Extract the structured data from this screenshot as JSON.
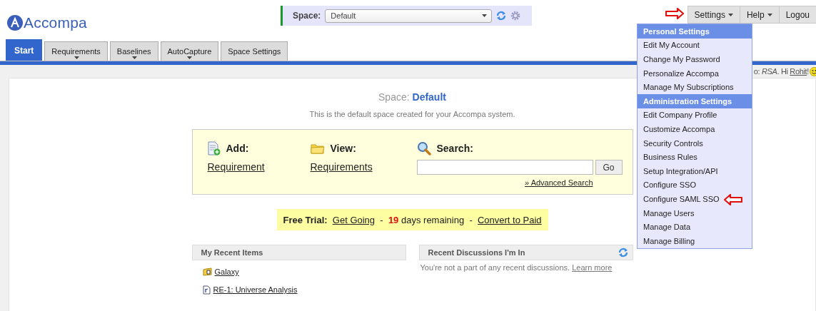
{
  "logo": {
    "text": "Accompa"
  },
  "space_selector": {
    "label": "Space:",
    "value": "Default"
  },
  "top_menu": [
    {
      "label": "Settings",
      "has_caret": true,
      "annotated": true
    },
    {
      "label": "Help",
      "has_caret": true,
      "annotated": false
    },
    {
      "label": "Logou",
      "has_caret": false,
      "annotated": false
    }
  ],
  "tabs": [
    {
      "label": "Start",
      "selected": true,
      "has_caret": false
    },
    {
      "label": "Requirements",
      "selected": false,
      "has_caret": true
    },
    {
      "label": "Baselines",
      "selected": false,
      "has_caret": true
    },
    {
      "label": "AutoCapture",
      "selected": false,
      "has_caret": true
    },
    {
      "label": "Space Settings",
      "selected": false,
      "has_caret": false
    }
  ],
  "greeting": {
    "text": "o: *RSA*. Hi ",
    "user": "Rohit",
    "tail": "!"
  },
  "space_title": {
    "label": "Space:",
    "name": "Default"
  },
  "description": "This is the default space created for your Accompa system.",
  "quick_panel": {
    "add": {
      "title": "Add:",
      "link": "Requirement"
    },
    "view": {
      "title": "View:",
      "link": "Requirements"
    },
    "search": {
      "title": "Search:",
      "button": "Go",
      "advanced": "» Advanced Search"
    }
  },
  "trial": {
    "label": "Free Trial:",
    "link": "Get Going",
    "sep1": "-",
    "days": "19",
    "days_text": "days remaining",
    "sep2": "-",
    "convert": "Convert to Paid"
  },
  "recent_items": {
    "title": "My Recent Items",
    "items": [
      {
        "label": "Galaxy",
        "kind": "folder"
      },
      {
        "label": "RE-1: Universe Analysis",
        "kind": "requirement"
      }
    ]
  },
  "discussions": {
    "title": "Recent Discussions I'm In",
    "message": "You're not a part of any recent discussions.",
    "link": "Learn more"
  },
  "settings_menu": {
    "items": [
      {
        "kind": "header",
        "label": "Personal Settings"
      },
      {
        "kind": "item",
        "label": "Edit My Account",
        "annotated": false
      },
      {
        "kind": "item",
        "label": "Change My Password",
        "annotated": false
      },
      {
        "kind": "item",
        "label": "Personalize Accompa",
        "annotated": false
      },
      {
        "kind": "item",
        "label": "Manage My Subscriptions",
        "annotated": false
      },
      {
        "kind": "header",
        "label": "Administration Settings"
      },
      {
        "kind": "item",
        "label": "Edit Company Profile",
        "annotated": false
      },
      {
        "kind": "item",
        "label": "Customize Accompa",
        "annotated": false
      },
      {
        "kind": "item",
        "label": "Security Controls",
        "annotated": false
      },
      {
        "kind": "item",
        "label": "Business Rules",
        "annotated": false
      },
      {
        "kind": "item",
        "label": "Setup Integration/API",
        "annotated": false
      },
      {
        "kind": "item",
        "label": "Configure SSO",
        "annotated": false
      },
      {
        "kind": "item",
        "label": "Configure SAML SSO",
        "annotated": true
      },
      {
        "kind": "item",
        "label": "Manage Users",
        "annotated": false
      },
      {
        "kind": "item",
        "label": "Manage Data",
        "annotated": false
      },
      {
        "kind": "item",
        "label": "Manage Billing",
        "annotated": false
      }
    ]
  }
}
